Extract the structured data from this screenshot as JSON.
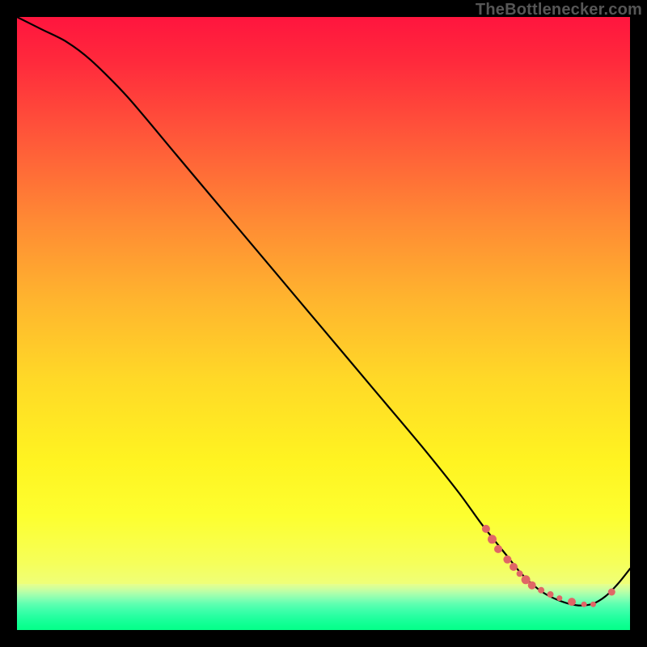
{
  "attribution": "TheBottlenecker.com",
  "chart_data": {
    "type": "line",
    "title": "",
    "xlabel": "",
    "ylabel": "",
    "xlim": [
      0,
      100
    ],
    "ylim": [
      0,
      100
    ],
    "series": [
      {
        "name": "curve",
        "x": [
          0,
          4,
          8,
          12,
          18,
          26,
          34,
          42,
          50,
          58,
          66,
          72,
          76,
          80,
          82,
          84,
          86,
          88,
          90,
          92,
          94,
          96,
          98,
          100
        ],
        "y": [
          100,
          98,
          96,
          93,
          87,
          77.5,
          68,
          58.5,
          49,
          39.5,
          30,
          22.5,
          17,
          12,
          9.5,
          7.5,
          6,
          5,
          4.3,
          4,
          4.3,
          5.5,
          7.5,
          10
        ]
      }
    ],
    "markers": {
      "name": "highlight-dots",
      "x": [
        76.5,
        77.5,
        78.5,
        80,
        81,
        82,
        83,
        84,
        85.5,
        87,
        88.5,
        90.5,
        92.5,
        94,
        97
      ],
      "y": [
        16.5,
        14.8,
        13.2,
        11.5,
        10.3,
        9.2,
        8.2,
        7.3,
        6.5,
        5.8,
        5.2,
        4.6,
        4.2,
        4.2,
        6.2
      ],
      "r": [
        5.0,
        5.5,
        5.0,
        5.0,
        5.0,
        4.0,
        5.5,
        5.0,
        4.0,
        4.0,
        3.5,
        5.0,
        3.5,
        3.5,
        4.5
      ]
    }
  }
}
